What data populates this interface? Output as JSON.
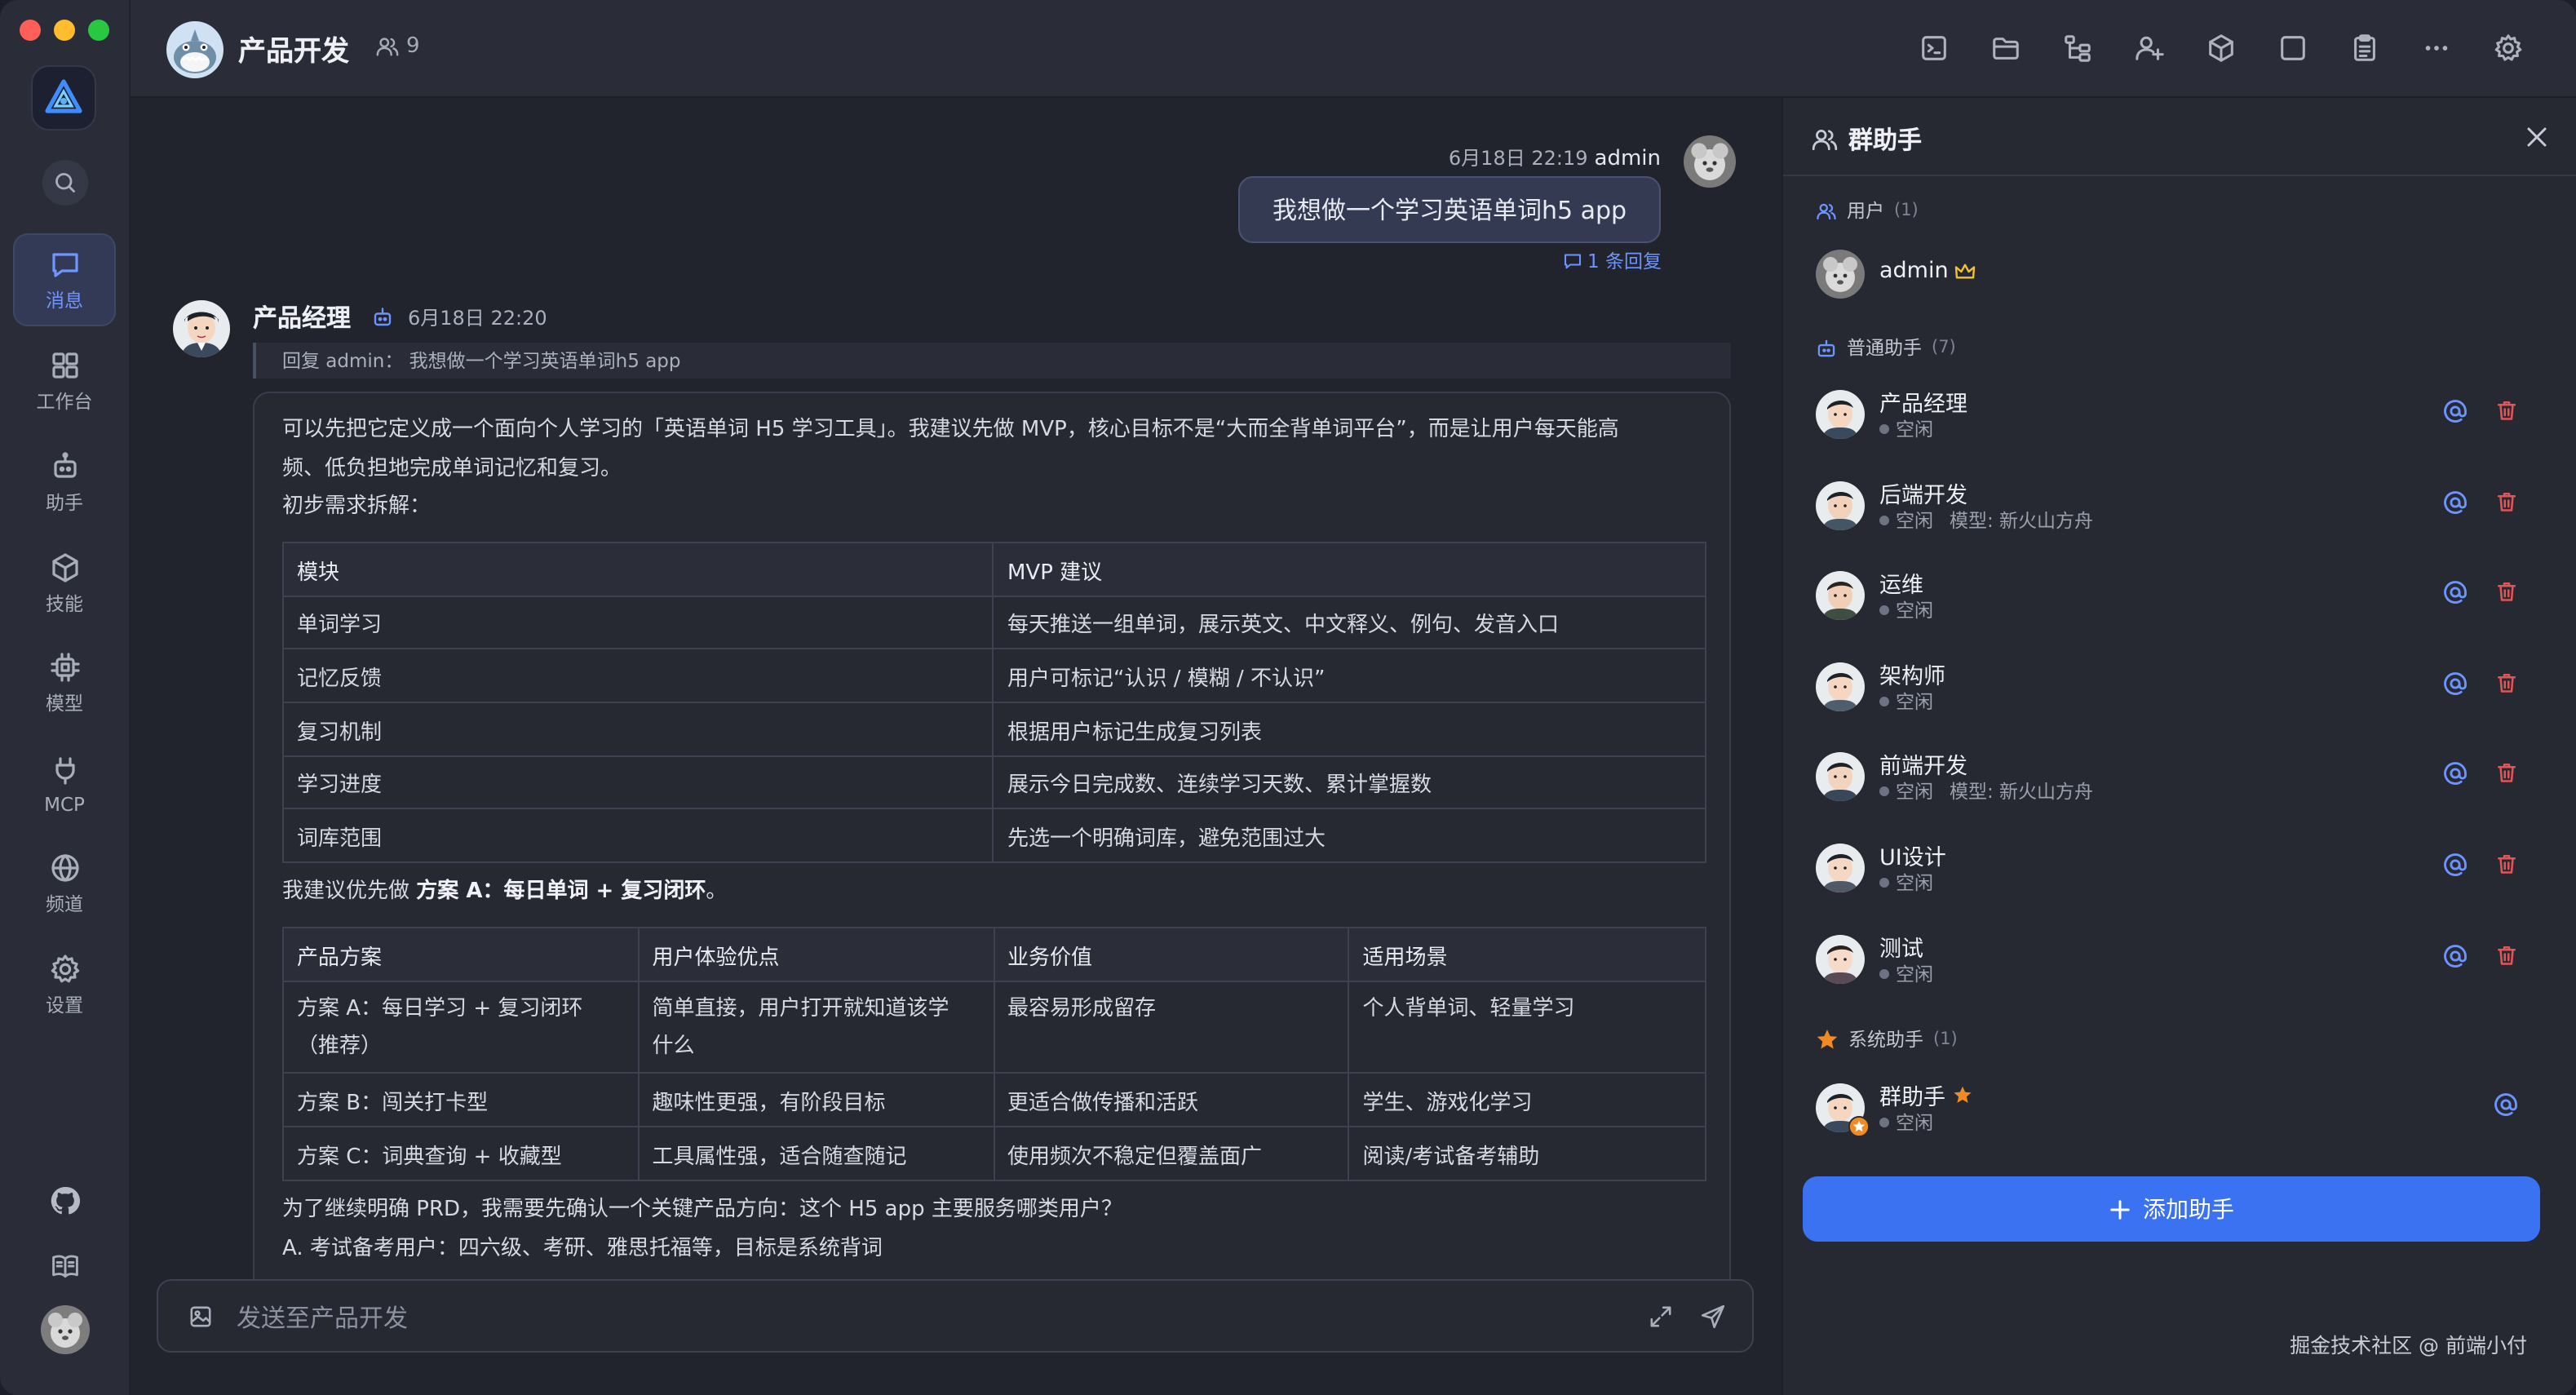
{
  "topbar": {
    "group_name": "产品开发",
    "member_count": "9",
    "toolbar_icons": [
      "terminal-icon",
      "folder-icon",
      "tree-icon",
      "add-user-icon",
      "cube-icon",
      "square-icon",
      "clipboard-icon",
      "more-icon",
      "settings-icon"
    ]
  },
  "sidebar": {
    "items": [
      {
        "label": "消息",
        "icon": "message-icon"
      },
      {
        "label": "工作台",
        "icon": "dashboard-icon"
      },
      {
        "label": "助手",
        "icon": "robot-icon"
      },
      {
        "label": "技能",
        "icon": "cube-icon"
      },
      {
        "label": "模型",
        "icon": "chip-icon"
      },
      {
        "label": "MCP",
        "icon": "plug-icon"
      },
      {
        "label": "频道",
        "icon": "globe-icon"
      },
      {
        "label": "设置",
        "icon": "gear-icon"
      }
    ]
  },
  "chat": {
    "user_message": {
      "time": "6月18日 22:19",
      "author": "admin",
      "text": "我想做一个学习英语单词h5 app",
      "reply_count": "1 条回复"
    },
    "bot_message": {
      "author": "产品经理",
      "time": "6月18日 22:20",
      "quote": "回复 admin： 我想做一个学习英语单词h5 app",
      "intro_line1": "可以先把它定义成一个面向个人学习的「英语单词 H5 学习工具」。我建议先做 MVP，核心目标不是“大而全背单词平台”，而是让用户每天能高",
      "intro_line2": "频、低负担地完成单词记忆和复习。",
      "breakdown_label": "初步需求拆解：",
      "table1": {
        "headers": [
          "模块",
          "MVP 建议"
        ],
        "rows": [
          [
            "单词学习",
            "每天推送一组单词，展示英文、中文释义、例句、发音入口"
          ],
          [
            "记忆反馈",
            "用户可标记“认识 / 模糊 / 不认识”"
          ],
          [
            "复习机制",
            "根据用户标记生成复习列表"
          ],
          [
            "学习进度",
            "展示今日完成数、连续学习天数、累计掌握数"
          ],
          [
            "词库范围",
            "先选一个明确词库，避免范围过大"
          ]
        ]
      },
      "recommend_prefix": "我建议优先做 ",
      "recommend_bold": "方案 A：每日单词 + 复习闭环",
      "recommend_suffix": "。",
      "table2": {
        "headers": [
          "产品方案",
          "用户体验优点",
          "业务价值",
          "适用场景"
        ],
        "rows": [
          [
            "方案 A：每日学习 + 复习闭环\n（推荐）",
            "简单直接，用户打开就知道该学\n什么",
            "最容易形成留存",
            "个人背单词、轻量学习"
          ],
          [
            "方案 B：闯关打卡型",
            "趣味性更强，有阶段目标",
            "更适合做传播和活跃",
            "学生、游戏化学习"
          ],
          [
            "方案 C：词典查询 + 收藏型",
            "工具属性强，适合随查随记",
            "使用频次不稳定但覆盖面广",
            "阅读/考试备考辅助"
          ]
        ]
      },
      "question": "为了继续明确 PRD，我需要先确认一个关键产品方向：这个 H5 app 主要服务哪类用户？",
      "option_a": "A. 考试备考用户：四六级、考研、雅思托福等，目标是系统背词"
    },
    "composer": {
      "placeholder": "发送至产品开发"
    }
  },
  "panel": {
    "title": "群助手",
    "users_section": {
      "label": "用户",
      "count": "(1)"
    },
    "users": [
      {
        "name": "admin"
      }
    ],
    "agents_section": {
      "label": "普通助手",
      "count": "(7)"
    },
    "agents": [
      {
        "name": "产品经理",
        "status": "空闲",
        "model": ""
      },
      {
        "name": "后端开发",
        "status": "空闲",
        "model": "模型: 新火山方舟"
      },
      {
        "name": "运维",
        "status": "空闲",
        "model": ""
      },
      {
        "name": "架构师",
        "status": "空闲",
        "model": ""
      },
      {
        "name": "前端开发",
        "status": "空闲",
        "model": "模型: 新火山方舟"
      },
      {
        "name": "UI设计",
        "status": "空闲",
        "model": ""
      },
      {
        "name": "测试",
        "status": "空闲",
        "model": ""
      }
    ],
    "system_section": {
      "label": "系统助手",
      "count": "(1)"
    },
    "system_agents": [
      {
        "name": "群助手",
        "status": "空闲"
      }
    ],
    "add_button": "添加助手",
    "watermark": "掘金技术社区 @ 前端小付"
  },
  "colors": {
    "accent": "#3b72f2",
    "link": "#6d93ff",
    "danger": "#e05656",
    "star": "#f08a24"
  }
}
